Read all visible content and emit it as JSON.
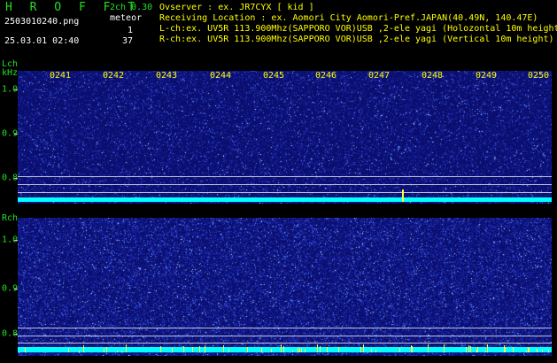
{
  "header": {
    "app_title": "H R O F F T",
    "version": "2ch 0.30",
    "file_name": "2503010240.png",
    "datetime": "25.03.01 02:40",
    "meteor_label": "meteor",
    "count_l": "1",
    "count_r": "37",
    "info_lines": [
      "Ovserver          : ex. JR7CYX [ kid ]",
      "Receiving Location : ex. Aomori City Aomori-Pref.JAPAN(40.49N, 140.47E)",
      "L-ch:ex. UV5R 113.900Mhz(SAPPORO VOR)USB ,2-ele yagi (Holozontal 10m height)",
      "R-ch:ex. UV5R 113.900Mhz(SAPPORO VOR)USB ,2-ele yagi (Vertical 10m height)"
    ]
  },
  "lch": {
    "label": "Lch",
    "unit": "kHz",
    "y_ticks": [
      "1.0",
      "0.9",
      "0.8"
    ]
  },
  "rch": {
    "label": "Rch",
    "y_ticks": [
      "1.0",
      "0.9",
      "0.8"
    ]
  },
  "time_ticks": [
    "0241",
    "0242",
    "0243",
    "0244",
    "0245",
    "0246",
    "0247",
    "0248",
    "0249",
    "0250"
  ],
  "colors": {
    "background": "#000000",
    "label_green": "#22e022",
    "label_yellow": "#ffff00",
    "spectrogram_base": "#0a0e6e",
    "noise_floor": "#00ffff"
  }
}
